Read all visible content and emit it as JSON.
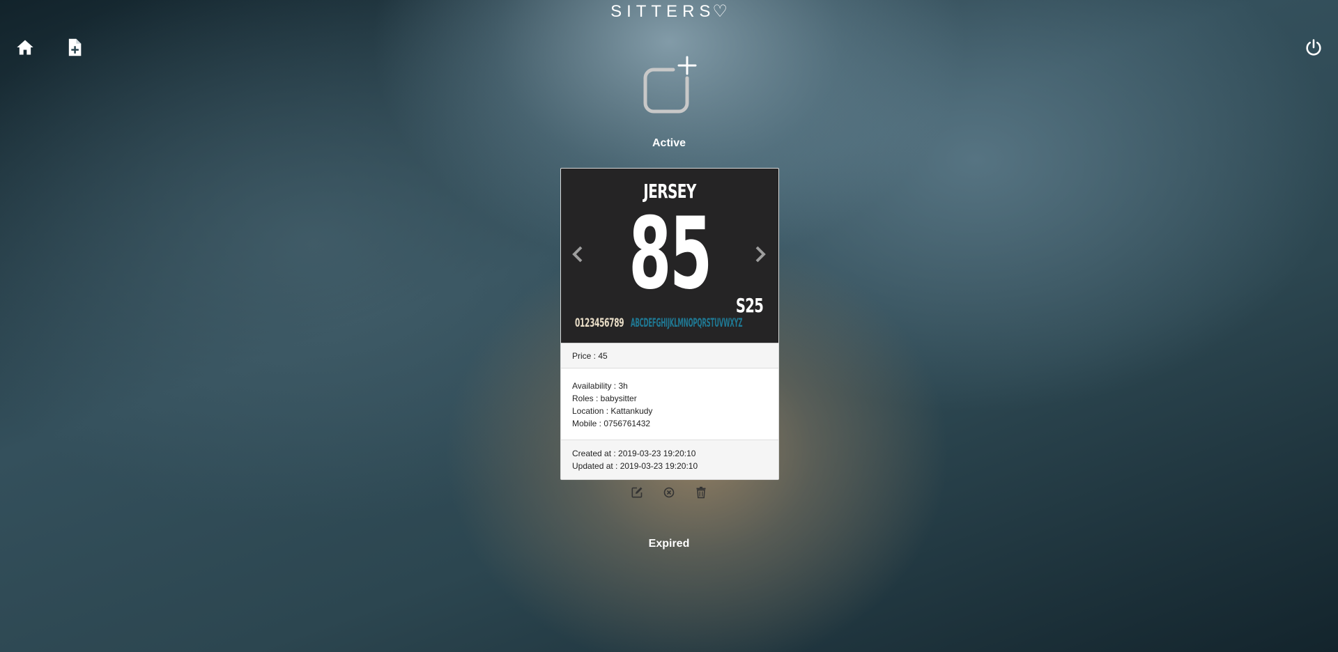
{
  "header": {
    "brand_text": "SITTERS",
    "brand_heart": "♡"
  },
  "nav": {
    "home_icon": "home-icon",
    "new_post_icon": "file-plus-icon",
    "logout_icon": "power-icon"
  },
  "add_post_icon": "add-square-icon",
  "sections": {
    "active_title": "Active",
    "expired_title": "Expired"
  },
  "card": {
    "image": {
      "title": "JERSEY",
      "number": "85",
      "code": "S25",
      "digits": "0123456789",
      "letters": "ABCDEFGHIJKLMNOPQRSTUVWXYZ"
    },
    "price": "Price : 45",
    "availability": "Availability : 3h",
    "roles": "Roles : babysitter",
    "location": "Location : Kattankudy",
    "mobile": "Mobile : 0756761432",
    "created_at": "Created at : 2019-03-23 19:20:10",
    "updated_at": "Updated at : 2019-03-23 19:20:10"
  },
  "actions": {
    "edit_icon": "edit-icon",
    "deactivate_icon": "cancel-circle-icon",
    "delete_icon": "trash-icon"
  },
  "colors": {
    "icon_white": "#ffffff",
    "action_icon": "#333333",
    "card_image_bg": "#252425",
    "letters_blue": "#1f7893"
  }
}
